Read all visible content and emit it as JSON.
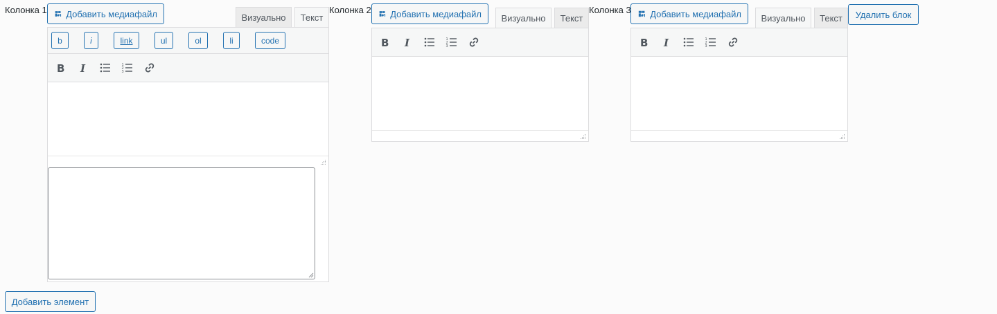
{
  "columns": [
    {
      "label": "Колонка 1"
    },
    {
      "label": "Колонка 2"
    },
    {
      "label": "Колонка 3"
    }
  ],
  "media_button_label": "Добавить медиафайл",
  "tabs": {
    "visual": "Визуально",
    "text": "Текст"
  },
  "quicktags": [
    "b",
    "i",
    "link",
    "ul",
    "ol",
    "li",
    "code"
  ],
  "delete_block_label": "Удалить блок",
  "add_element_label": "Добавить элемент",
  "colors": {
    "accent": "#2271b1",
    "border": "#dcdcde",
    "toolbar_bg": "#f6f7f7"
  }
}
